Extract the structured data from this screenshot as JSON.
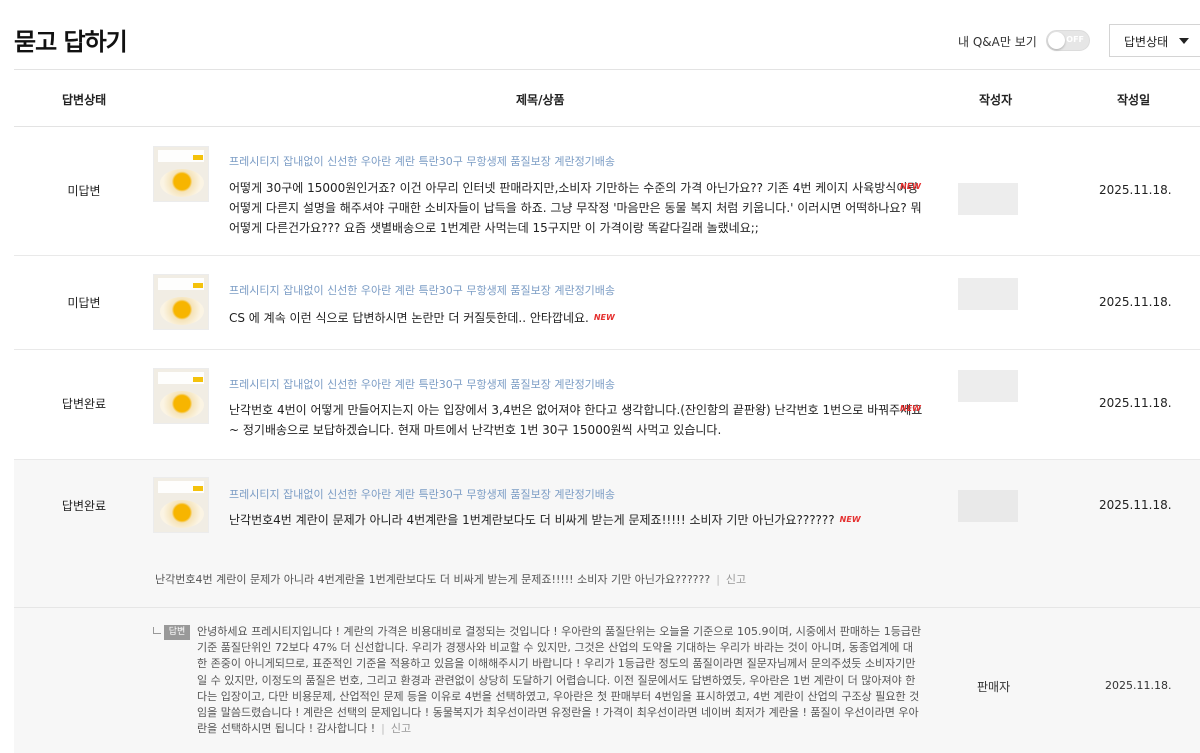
{
  "header": {
    "title": "묻고 답하기",
    "my_qa_label": "내 Q&A만 보기",
    "toggle_state": "OFF",
    "status_filter": "답변상태"
  },
  "table": {
    "columns": [
      "답변상태",
      "제목/상품",
      "작성자",
      "작성일"
    ]
  },
  "rows": [
    {
      "status": "미답변",
      "product": "프레시티지 잡내없이 신선한 우아란 계란 특란30구 무항생제 품질보장 계란정기배송",
      "question": "어떻게 30구에 15000원인거죠? 이건 아무리 인터넷 판매라지만,소비자 기만하는 수준의 가격 아닌가요?? 기존 4번 케이지 사육방식이랑 어떻게 다른지 설명을 해주셔야 구매한 소비자들이 납득을 하죠. 그냥 무작정 '마음만은 동물 복지 처럼 키웁니다.' 이러시면 어떡하나요? 뭐 어떻게 다른건가요??? 요즘 샛별배송으로 1번계란 사먹는데 15구지만 이 가격이랑 똑같다길래 놀랬네요;;",
      "badge": "NEW",
      "date": "2025.11.18."
    },
    {
      "status": "미답변",
      "product": "프레시티지 잡내없이 신선한 우아란 계란 특란30구 무항생제 품질보장 계란정기배송",
      "question": "CS 에 계속 이런 식으로 답변하시면 논란만 더 커질듯한데.. 안타깝네요.",
      "badge": "NEW",
      "date": "2025.11.18."
    },
    {
      "status": "답변완료",
      "product": "프레시티지 잡내없이 신선한 우아란 계란 특란30구 무항생제 품질보장 계란정기배송",
      "question": "난각번호 4번이 어떻게 만들어지는지 아는 입장에서 3,4번은 없어져야 한다고 생각합니다.(잔인함의 끝판왕) 난각번호 1번으로 바꿔주세요~ 정기배송으로 보답하겠습니다. 현재 마트에서 난각번호 1번 30구 15000원씩 사먹고 있습니다.",
      "badge": "NEW",
      "date": "2025.11.18."
    },
    {
      "status": "답변완료",
      "product": "프레시티지 잡내없이 신선한 우아란 계란 특란30구 무항생제 품질보장 계란정기배송",
      "question": "난각번호4번 계란이 문제가 아니라 4번계란을 1번계란보다도 더 비싸게 받는게 문제죠!!!!! 소비자 기만 아닌가요??????",
      "badge": "NEW",
      "date": "2025.11.18."
    }
  ],
  "detail": {
    "question": "난각번호4번 계란이 문제가 아니라 4번계란을 1번계란보다도 더 비싸게 받는게 문제죠!!!!! 소비자 기만 아닌가요??????",
    "separator": "|",
    "report": "신고",
    "answer_badge": "답변",
    "answer": "안녕하세요 프레시티지입니다 ! 계란의 가격은 비용대비로 결정되는 것입니다 ! 우아란의 품질단위는 오늘을 기준으로 105.9이며, 시중에서 판매하는 1등급란 기준 품질단위인 72보다 47% 더 신선합니다. 우리가 경쟁사와 비교할 수 있지만, 그것은 산업의 도약을 기대하는 우리가 바라는 것이 아니며, 동종업계에 대한 존중이 아니게되므로, 표준적인 기준을 적용하고 있음을 이해해주시기 바랍니다 ! 우리가 1등급란 정도의 품질이라면 질문자님께서 문의주셨듯 소비자기만일 수 있지만, 이정도의 품질은 번호, 그리고 환경과 관련없이 상당히 도달하기 어렵습니다. 이전 질문에서도 답변하였듯, 우아란은 1번 계란이 더 많아져야 한다는 입장이고, 다만 비용문제, 산업적인 문제 등을 이유로 4번을 선택하였고, 우아란은 첫 판매부터 4번임을 표시하였고, 4번 계란이 산업의 구조상 필요한 것임을 말씀드렸습니다 ! 계란은 선택의 문제입니다 ! 동물복지가 최우선이라면 유정란을 ! 가격이 최우선이라면 네이버 최저가 계란을 ! 품질이 우선이라면 우아란을 선택하시면 됩니다 ! 감사합니다 !",
    "author": "판매자",
    "date": "2025.11.18."
  }
}
